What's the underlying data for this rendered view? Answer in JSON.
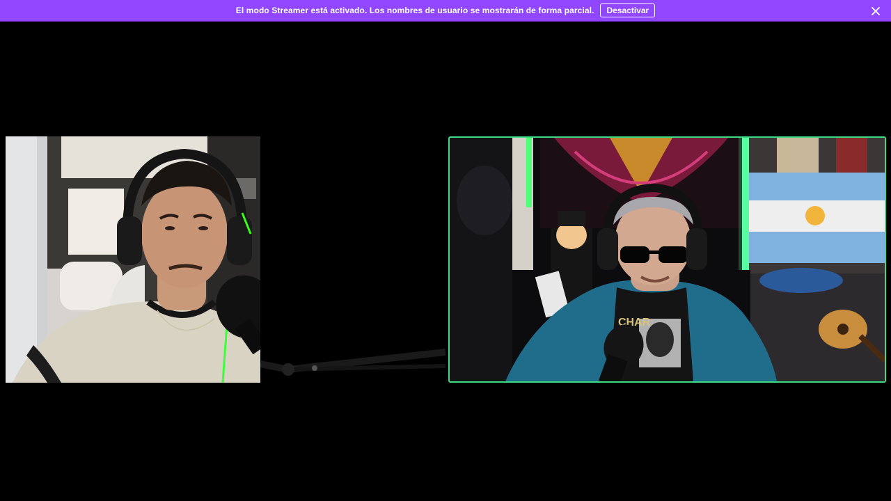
{
  "banner": {
    "message": "El modo Streamer está activado. Los nombres de usuario se mostrarán de forma parcial.",
    "button_label": "Desactivar",
    "close_icon": "close-icon",
    "background": "#9147ff"
  },
  "participants": [
    {
      "position": "left",
      "speaking": false
    },
    {
      "position": "right",
      "speaking": true,
      "highlight_color": "#3ddc84"
    }
  ]
}
